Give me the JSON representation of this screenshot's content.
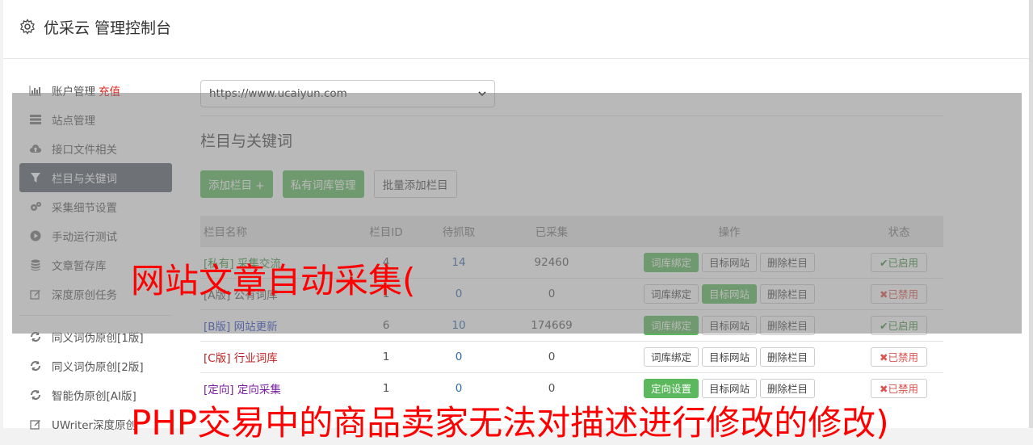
{
  "header": {
    "title": "优采云 管理控制台"
  },
  "sidebar": {
    "items": [
      {
        "label": "账户管理",
        "badge": "充值",
        "icon": "bar-chart-icon"
      },
      {
        "label": "站点管理",
        "icon": "server-icon"
      },
      {
        "label": "接口文件相关",
        "icon": "cloud-upload-icon"
      },
      {
        "label": "栏目与关键词",
        "icon": "filter-icon",
        "active": true
      },
      {
        "label": "采集细节设置",
        "icon": "cogs-icon"
      },
      {
        "label": "手动运行测试",
        "icon": "play-circle-icon"
      },
      {
        "label": "文章暂存库",
        "icon": "database-icon"
      },
      {
        "label": "深度原创任务",
        "icon": "edit-icon"
      }
    ],
    "items2": [
      {
        "label": "同义词伪原创[1版]",
        "icon": "refresh-icon"
      },
      {
        "label": "同义词伪原创[2版]",
        "icon": "refresh-icon"
      },
      {
        "label": "智能伪原创[AI版]",
        "icon": "refresh-icon"
      },
      {
        "label": "UWriter深度原创",
        "icon": "edit-icon"
      }
    ]
  },
  "site_select": {
    "value": "https://www.ucaiyun.com"
  },
  "section": {
    "title": "栏目与关键词"
  },
  "toolbar": {
    "add_label": "添加栏目 +",
    "private_label": "私有词库管理",
    "batch_label": "批量添加栏目"
  },
  "table": {
    "headers": {
      "name": "栏目名称",
      "id": "栏目ID",
      "pending": "待抓取",
      "collected": "已采集",
      "ops": "操作",
      "state": "状态"
    },
    "rows": [
      {
        "tag": "[私有]",
        "name": "采集交流",
        "id": "4",
        "pending": "14",
        "collected": "92460",
        "op1": "词库绑定",
        "op2": "目标网站",
        "op3": "删除栏目",
        "state": "✔已启用"
      },
      {
        "tag": "[A版]",
        "name": "公有词库",
        "id": "1",
        "pending": "0",
        "collected": "0",
        "op1": "词库绑定",
        "op2": "目标网站",
        "op3": "删除栏目",
        "state": "✖已禁用"
      },
      {
        "tag": "[B版]",
        "name": "网站更新",
        "id": "6",
        "pending": "10",
        "collected": "174669",
        "op1": "词库绑定",
        "op2": "目标网站",
        "op3": "删除栏目",
        "state": "✔已启用"
      },
      {
        "tag": "[C版]",
        "name": "行业词库",
        "id": "1",
        "pending": "0",
        "collected": "0",
        "op1": "词库绑定",
        "op2": "目标网站",
        "op3": "删除栏目",
        "state": "✖已禁用"
      },
      {
        "tag": "[定向]",
        "name": "定向采集",
        "id": "1",
        "pending": "0",
        "collected": "0",
        "op1": "定向设置",
        "op2": "目标网站",
        "op3": "删除栏目",
        "state": "✖已禁用"
      }
    ]
  },
  "watermark": {
    "line1": "网站文章自动采集(",
    "line2": "PHP交易中的商品卖家无法对描述进行修改的修改)"
  }
}
